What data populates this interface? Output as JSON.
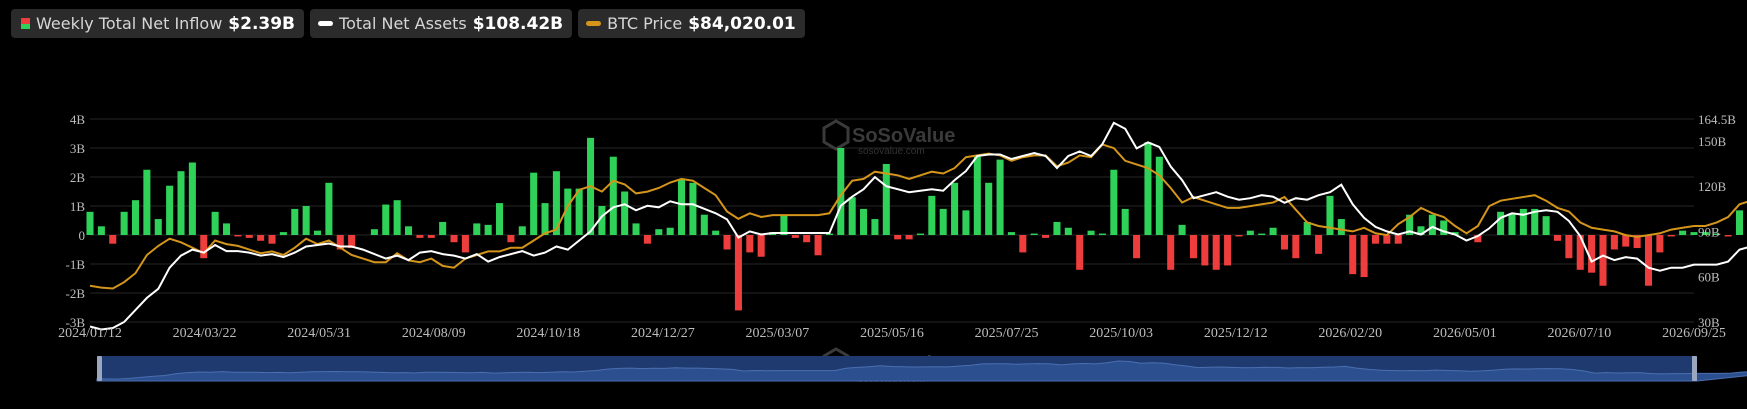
{
  "legend": {
    "inflow": {
      "label": "Weekly Total Net Inflow",
      "value": "$2.39B"
    },
    "assets": {
      "label": "Total Net Assets",
      "value": "$108.42B"
    },
    "btc": {
      "label": "BTC Price",
      "value": "$84,020.01"
    }
  },
  "watermark": {
    "brand": "SoSoValue",
    "sub": "sosovalue.com"
  },
  "colors": {
    "positive": "#2fd158",
    "negative": "#ee3d3d",
    "assets": "#ffffff",
    "btc": "#d4951b",
    "grid": "#262626",
    "axis": "#bdbdbd",
    "navigator": "#1f3a6e"
  },
  "chart_data": {
    "type": "bar",
    "x_tick_labels": [
      "2024/01/12",
      "2024/03/22",
      "2024/05/31",
      "2024/08/09",
      "2024/10/18",
      "2024/12/27",
      "2025/03/07",
      "2025/05/16",
      "2025/07/25",
      "2025/10/03",
      "2025/12/12",
      "2026/02/20",
      "2026/05/01",
      "2026/07/10",
      "2026/09/25"
    ],
    "left_axis": {
      "ticks": [
        "4B",
        "3B",
        "2B",
        "1B",
        "0",
        "-1B",
        "-2B",
        "-3B"
      ],
      "ylim": [
        -3,
        4
      ]
    },
    "right_axis": {
      "ticks": [
        "164.5B",
        "150B",
        "120B",
        "90B",
        "60B",
        "30B"
      ],
      "ylim": [
        30,
        164.5
      ]
    },
    "weeks": 142,
    "series": [
      {
        "name": "Weekly Total Net Inflow",
        "unit": "B USD",
        "values": [
          0.8,
          0.3,
          -0.3,
          0.8,
          1.2,
          2.25,
          0.55,
          1.7,
          2.2,
          2.5,
          -0.8,
          0.8,
          0.4,
          -0.05,
          -0.1,
          -0.2,
          -0.3,
          0.1,
          0.9,
          1.0,
          0.15,
          1.8,
          -0.5,
          -0.45,
          0.0,
          0.2,
          1.05,
          1.2,
          0.3,
          -0.1,
          -0.1,
          0.45,
          -0.25,
          -0.6,
          0.4,
          0.35,
          1.1,
          -0.25,
          0.3,
          2.15,
          1.1,
          2.2,
          1.6,
          1.6,
          3.35,
          1.0,
          2.7,
          1.5,
          0.4,
          -0.3,
          0.2,
          0.25,
          1.9,
          1.8,
          0.7,
          0.15,
          -0.5,
          -2.6,
          -0.6,
          -0.75,
          0.1,
          0.7,
          -0.1,
          -0.25,
          -0.7,
          0.05,
          3.0,
          1.3,
          0.9,
          0.55,
          2.45,
          -0.15,
          -0.15,
          0.05,
          1.35,
          0.9,
          1.8,
          0.85,
          2.7,
          1.8,
          2.6,
          0.1,
          -0.6,
          0.05,
          -0.1,
          0.45,
          0.25,
          -1.2,
          0.15,
          0.05,
          2.25,
          0.9,
          -0.8,
          3.2,
          2.7,
          -1.2,
          0.35,
          -0.8,
          -1.05,
          -1.2,
          -1.05,
          -0.05,
          0.15,
          0.05,
          0.25,
          -0.5,
          -0.8,
          0.45,
          -0.65,
          1.35,
          0.55,
          -1.35,
          -1.45,
          -0.3,
          -0.3,
          -0.3,
          0.7,
          0.3,
          0.7,
          0.5,
          0.1,
          0.0,
          -0.25,
          0.0,
          0.8,
          0.75,
          0.9,
          0.9,
          0.65,
          -0.2,
          -0.8,
          -1.2,
          -1.3,
          -1.75,
          -0.5,
          -0.4,
          -0.45,
          -1.75,
          -0.6,
          -0.05,
          0.15,
          0.1,
          0.1,
          0.05,
          -0.05,
          0.85,
          0.0,
          1.9,
          0.9,
          1.0,
          -0.45,
          2.39
        ]
      },
      {
        "name": "Total Net Assets",
        "unit": "B USD",
        "values": [
          27,
          25,
          26,
          30,
          38,
          46,
          52,
          66,
          74,
          78,
          76,
          81,
          77,
          77,
          76,
          74,
          75,
          73,
          76,
          80,
          81,
          82,
          80,
          80,
          78,
          75,
          72,
          74,
          71,
          76,
          77,
          75,
          74,
          72,
          75,
          70,
          73,
          75,
          77,
          74,
          76,
          80,
          78,
          84,
          90,
          100,
          106,
          108,
          104,
          107,
          106,
          110,
          108,
          108,
          105,
          102,
          98,
          86,
          90,
          88,
          89,
          89,
          89,
          89,
          89,
          89,
          107,
          113,
          118,
          126,
          120,
          118,
          116,
          117,
          118,
          117,
          124,
          130,
          140,
          141,
          141,
          138,
          140,
          142,
          140,
          132,
          140,
          143,
          140,
          148,
          162,
          158,
          145,
          149,
          146,
          133,
          124,
          112,
          114,
          116,
          113,
          111,
          112,
          114,
          113,
          109,
          112,
          111,
          114,
          116,
          121,
          108,
          99,
          93,
          90,
          88,
          90,
          88,
          93,
          90,
          88,
          84,
          87,
          92,
          99,
          102,
          101,
          103,
          104,
          103,
          97,
          87,
          70,
          74,
          71,
          73,
          72,
          66,
          64,
          66,
          66,
          68,
          68,
          68,
          70,
          78,
          80,
          92,
          97,
          96,
          99,
          98,
          108.42
        ]
      },
      {
        "name": "BTC Price",
        "unit": "USD",
        "values": [
          45000,
          44000,
          43500,
          47000,
          52000,
          62000,
          67000,
          71000,
          69000,
          66000,
          63000,
          70000,
          68000,
          67000,
          65000,
          63000,
          64000,
          62000,
          66000,
          71000,
          68000,
          70000,
          66000,
          62000,
          60000,
          58000,
          58000,
          63000,
          59000,
          58000,
          60000,
          56000,
          55000,
          60000,
          62000,
          64000,
          64000,
          66000,
          66000,
          70000,
          74000,
          76000,
          89000,
          98000,
          100000,
          97000,
          103000,
          101000,
          96000,
          97000,
          99000,
          102000,
          104000,
          103000,
          99000,
          95000,
          86000,
          82000,
          85000,
          83000,
          84000,
          84000,
          84000,
          84000,
          84000,
          85000,
          95000,
          103000,
          104000,
          108000,
          107000,
          106000,
          104000,
          106000,
          108000,
          107000,
          110000,
          116000,
          117000,
          118000,
          117000,
          114000,
          116000,
          117000,
          117000,
          111000,
          113000,
          117000,
          116000,
          123000,
          121000,
          114000,
          112000,
          110000,
          106000,
          99000,
          91000,
          94000,
          92000,
          90000,
          88000,
          88000,
          89000,
          90000,
          91000,
          94000,
          87000,
          80000,
          78000,
          77000,
          76000,
          75000,
          77000,
          74000,
          73000,
          79000,
          83000,
          88000,
          85000,
          83000,
          78000,
          74000,
          78000,
          89000,
          92000,
          93000,
          94000,
          95000,
          92000,
          88000,
          86000,
          80000,
          77000,
          76000,
          75000,
          73000,
          72000,
          73000,
          74000,
          76000,
          77000,
          78000,
          78000,
          80000,
          83000,
          90000,
          92000,
          94000,
          95000,
          92000,
          84020.01
        ]
      }
    ]
  }
}
